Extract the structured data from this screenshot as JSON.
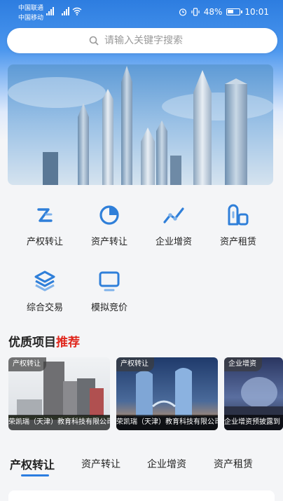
{
  "status_bar": {
    "carrier_1": "中国联通",
    "carrier_2": "中国移动",
    "battery": "48%",
    "time": "10:01"
  },
  "search": {
    "placeholder": "请输入关键字搜索"
  },
  "categories": [
    {
      "label": "产权转让",
      "icon": "equity-transfer-icon"
    },
    {
      "label": "资产转让",
      "icon": "pie-chart-icon"
    },
    {
      "label": "企业增资",
      "icon": "trend-line-icon"
    },
    {
      "label": "资产租赁",
      "icon": "building-lease-icon"
    },
    {
      "label": "综合交易",
      "icon": "layers-icon"
    },
    {
      "label": "模拟竞价",
      "icon": "monitor-icon"
    }
  ],
  "section": {
    "title_part_1": "优质项目",
    "title_part_2": "推荐"
  },
  "cards": [
    {
      "tag": "产权转让",
      "caption": "荣凯瑞（天津）教育科技有限公司增"
    },
    {
      "tag": "产权转让",
      "caption": "荣凯瑞（天津）教育科技有限公司增"
    },
    {
      "tag": "企业增资",
      "caption": "企业增资预披露到"
    }
  ],
  "tabs": [
    "产权转让",
    "资产转让",
    "企业增资",
    "资产租赁"
  ],
  "colors": {
    "accent": "#2b7de0",
    "icon": "#2f7fd9",
    "highlight": "#e0281e"
  }
}
